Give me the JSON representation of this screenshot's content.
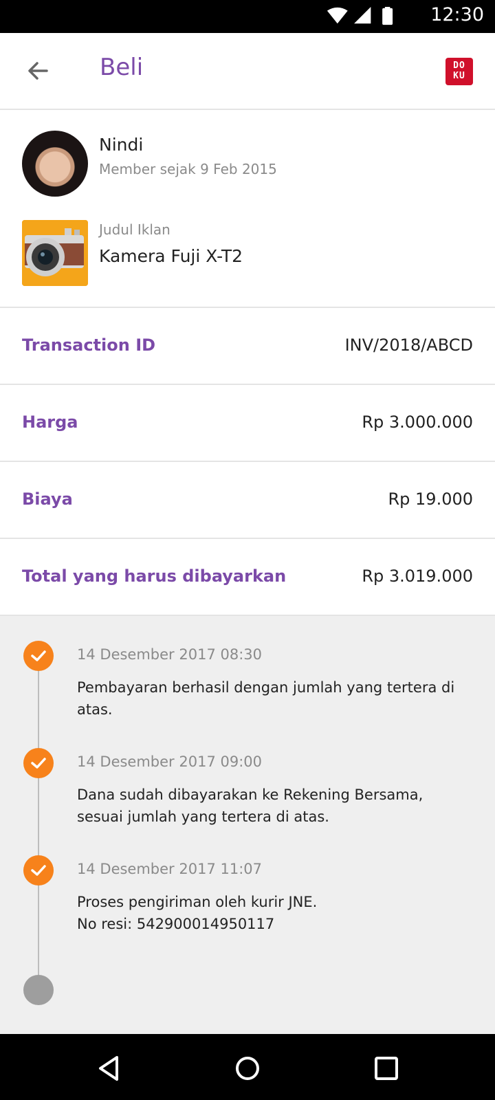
{
  "status_bar": {
    "time": "12:30",
    "icons": [
      "wifi-icon",
      "signal-icon",
      "battery-icon"
    ]
  },
  "app_bar": {
    "title": "Beli",
    "back_icon": "arrow-left-icon",
    "logo_text": "DOKU"
  },
  "seller": {
    "name": "Nindi",
    "member_since": "Member sejak 9 Feb 2015"
  },
  "ad": {
    "label": "Judul Iklan",
    "title": "Kamera Fuji X-T2"
  },
  "details": [
    {
      "label": "Transaction ID",
      "value": "INV/2018/ABCD"
    },
    {
      "label": "Harga",
      "value": "Rp 3.000.000"
    },
    {
      "label": "Biaya",
      "value": "Rp 19.000"
    },
    {
      "label": "Total yang harus dibayarkan",
      "value": "Rp 3.019.000"
    }
  ],
  "timeline": [
    {
      "time": "14 Desember 2017 08:30",
      "text": "Pembayaran berhasil dengan jumlah yang tertera di atas.",
      "status": "done"
    },
    {
      "time": "14 Desember 2017 09:00",
      "text": "Dana sudah dibayarakan ke Rekening Bersama, sesuai jumlah yang tertera di atas.",
      "status": "done"
    },
    {
      "time": "14 Desember 2017 11:07",
      "text_line1": "Proses pengiriman oleh kurir JNE.",
      "text_line2": "No resi: 542900014950117",
      "status": "done"
    },
    {
      "status": "pending"
    }
  ],
  "colors": {
    "accent": "#7b4aa8",
    "timeline_done": "#f7821b",
    "timeline_pending": "#9e9e9e",
    "logo": "#d0102b"
  },
  "nav_bar": {
    "icons": [
      "back-triangle-icon",
      "home-circle-icon",
      "recents-square-icon"
    ]
  }
}
